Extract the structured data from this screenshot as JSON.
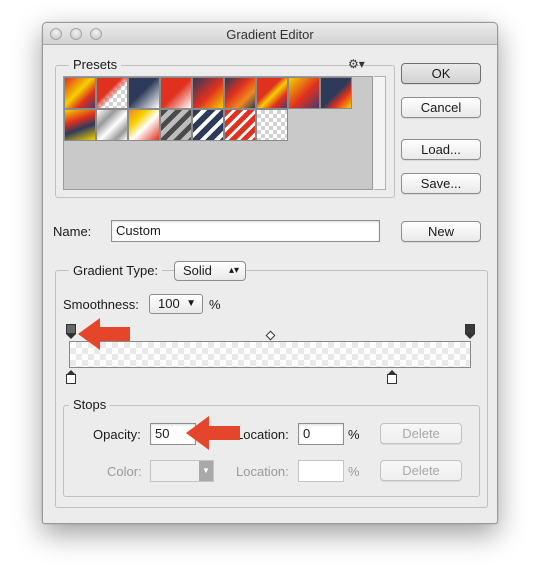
{
  "window": {
    "title": "Gradient Editor"
  },
  "presets": {
    "group_label": "Presets"
  },
  "buttons": {
    "ok": "OK",
    "cancel": "Cancel",
    "load": "Load...",
    "save": "Save...",
    "new": "New"
  },
  "name": {
    "label": "Name:",
    "value": "Custom"
  },
  "gradient": {
    "type_label": "Gradient Type:",
    "type_value": "Solid",
    "smoothness_label": "Smoothness:",
    "smoothness_value": "100",
    "smoothness_unit": "%"
  },
  "stops": {
    "group_label": "Stops",
    "opacity_label": "Opacity:",
    "opacity_value": "50",
    "opacity_location_label": "Location:",
    "opacity_location_value": "0",
    "opacity_location_unit": "%",
    "delete_label": "Delete",
    "color_label": "Color:",
    "color_location_label": "Location:",
    "color_location_value": "",
    "color_location_unit": "%",
    "delete_label_2": "Delete"
  },
  "icons": {
    "presets_menu": "gear-icon",
    "popup_arrow": "up-down-arrows-icon",
    "dropdown_arrow": "chevron-down-icon"
  },
  "colors": {
    "annotation_arrow": "#e5452b",
    "preset_red": "#e0301e",
    "preset_yellow": "#f5d000",
    "preset_navy": "#2d3a5a"
  }
}
